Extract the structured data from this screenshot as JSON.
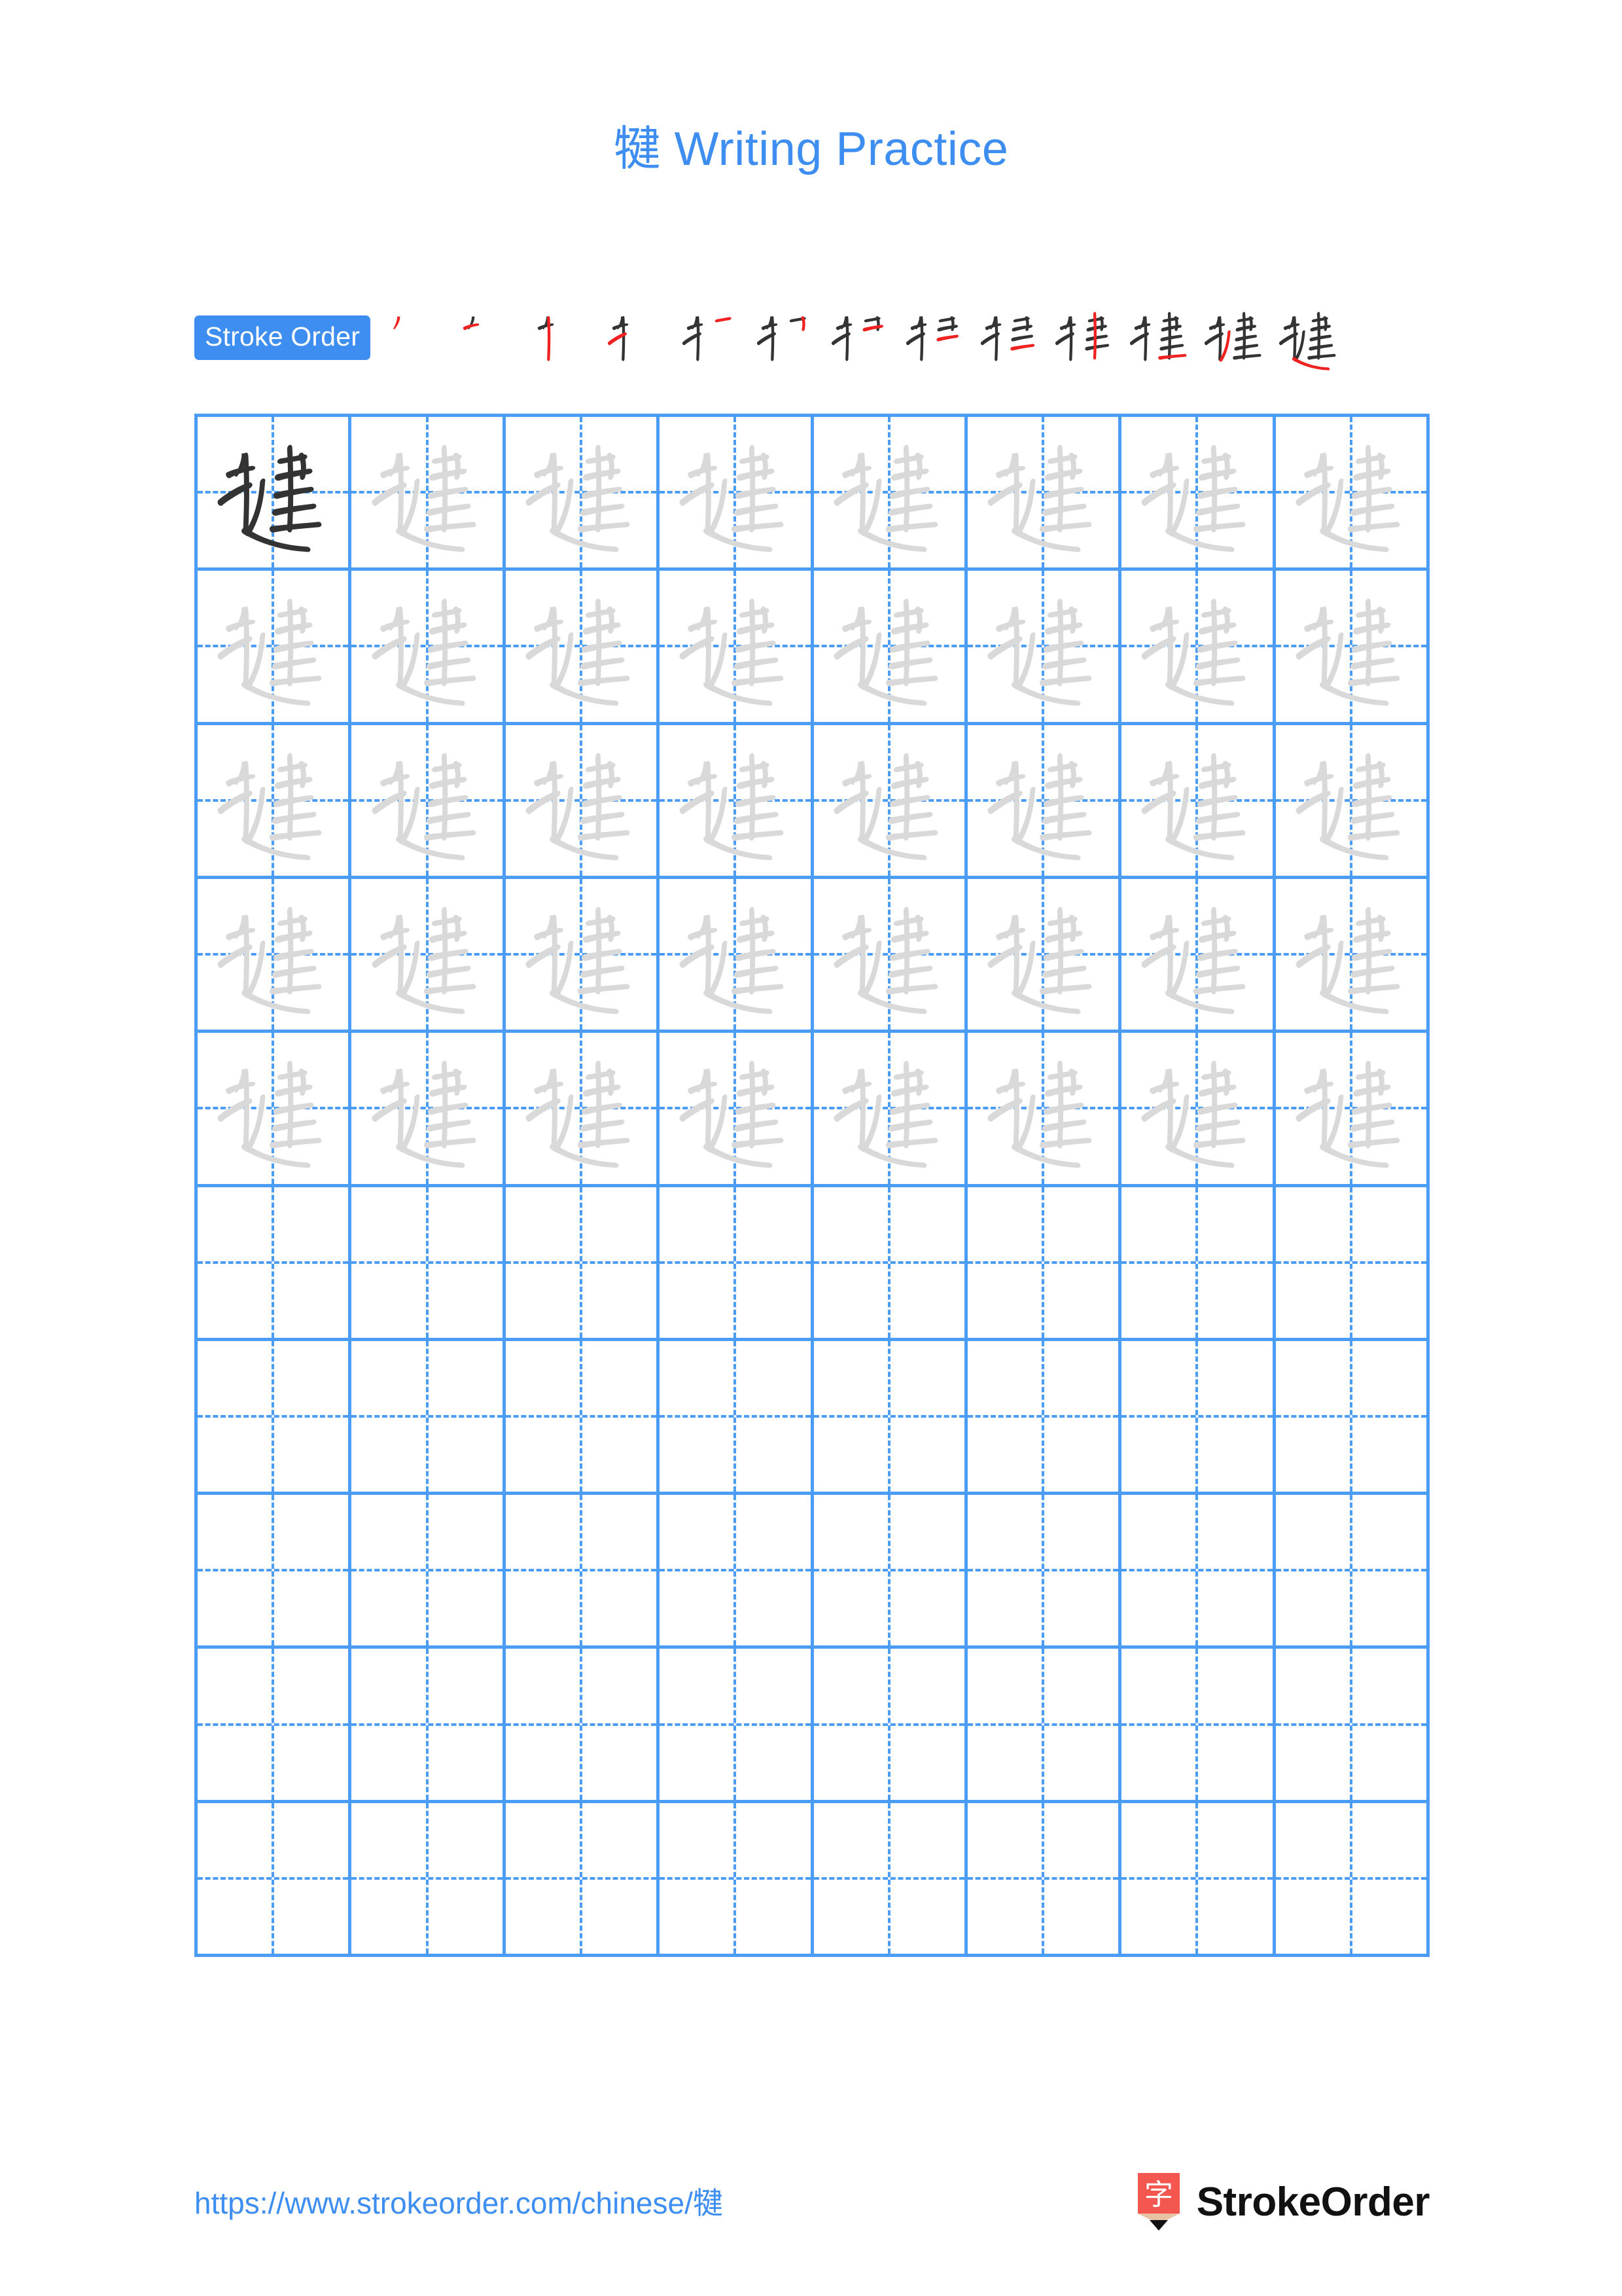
{
  "document": {
    "character": "犍",
    "title_suffix": " Writing Practice",
    "title_full": "犍 Writing Practice"
  },
  "stroke_order": {
    "badge_label": "Stroke Order",
    "total_strokes": 13,
    "new_stroke_color": "#ef2121",
    "drawn_stroke_color": "#333333",
    "steps": [
      {
        "index": 1,
        "strokes_shown": 1
      },
      {
        "index": 2,
        "strokes_shown": 2
      },
      {
        "index": 3,
        "strokes_shown": 3
      },
      {
        "index": 4,
        "strokes_shown": 4
      },
      {
        "index": 5,
        "strokes_shown": 5
      },
      {
        "index": 6,
        "strokes_shown": 6
      },
      {
        "index": 7,
        "strokes_shown": 7
      },
      {
        "index": 8,
        "strokes_shown": 8
      },
      {
        "index": 9,
        "strokes_shown": 9
      },
      {
        "index": 10,
        "strokes_shown": 10
      },
      {
        "index": 11,
        "strokes_shown": 11
      },
      {
        "index": 12,
        "strokes_shown": 12
      },
      {
        "index": 13,
        "strokes_shown": 13
      }
    ]
  },
  "grid": {
    "columns": 8,
    "rows": 10,
    "grid_line_color": "#4a9cf5",
    "model_glyph_color": "#333333",
    "trace_glyph_color": "#d9d9d9",
    "rows_data": [
      {
        "row": 1,
        "cells": [
          "model",
          "trace",
          "trace",
          "trace",
          "trace",
          "trace",
          "trace",
          "trace"
        ]
      },
      {
        "row": 2,
        "cells": [
          "trace",
          "trace",
          "trace",
          "trace",
          "trace",
          "trace",
          "trace",
          "trace"
        ]
      },
      {
        "row": 3,
        "cells": [
          "trace",
          "trace",
          "trace",
          "trace",
          "trace",
          "trace",
          "trace",
          "trace"
        ]
      },
      {
        "row": 4,
        "cells": [
          "trace",
          "trace",
          "trace",
          "trace",
          "trace",
          "trace",
          "trace",
          "trace"
        ]
      },
      {
        "row": 5,
        "cells": [
          "trace",
          "trace",
          "trace",
          "trace",
          "trace",
          "trace",
          "trace",
          "trace"
        ]
      },
      {
        "row": 6,
        "cells": [
          "empty",
          "empty",
          "empty",
          "empty",
          "empty",
          "empty",
          "empty",
          "empty"
        ]
      },
      {
        "row": 7,
        "cells": [
          "empty",
          "empty",
          "empty",
          "empty",
          "empty",
          "empty",
          "empty",
          "empty"
        ]
      },
      {
        "row": 8,
        "cells": [
          "empty",
          "empty",
          "empty",
          "empty",
          "empty",
          "empty",
          "empty",
          "empty"
        ]
      },
      {
        "row": 9,
        "cells": [
          "empty",
          "empty",
          "empty",
          "empty",
          "empty",
          "empty",
          "empty",
          "empty"
        ]
      },
      {
        "row": 10,
        "cells": [
          "empty",
          "empty",
          "empty",
          "empty",
          "empty",
          "empty",
          "empty",
          "empty"
        ]
      }
    ]
  },
  "footer": {
    "url": "https://www.strokeorder.com/chinese/犍",
    "brand_name": "StrokeOrder",
    "brand_mark_character": "字",
    "brand_mark_color": "#f4574f"
  },
  "colors": {
    "accent_blue": "#3d8ef0",
    "grid_blue": "#4a9cf5",
    "stroke_red": "#ef2121",
    "ink_dark": "#333333",
    "trace_gray": "#d9d9d9",
    "background": "#ffffff"
  }
}
